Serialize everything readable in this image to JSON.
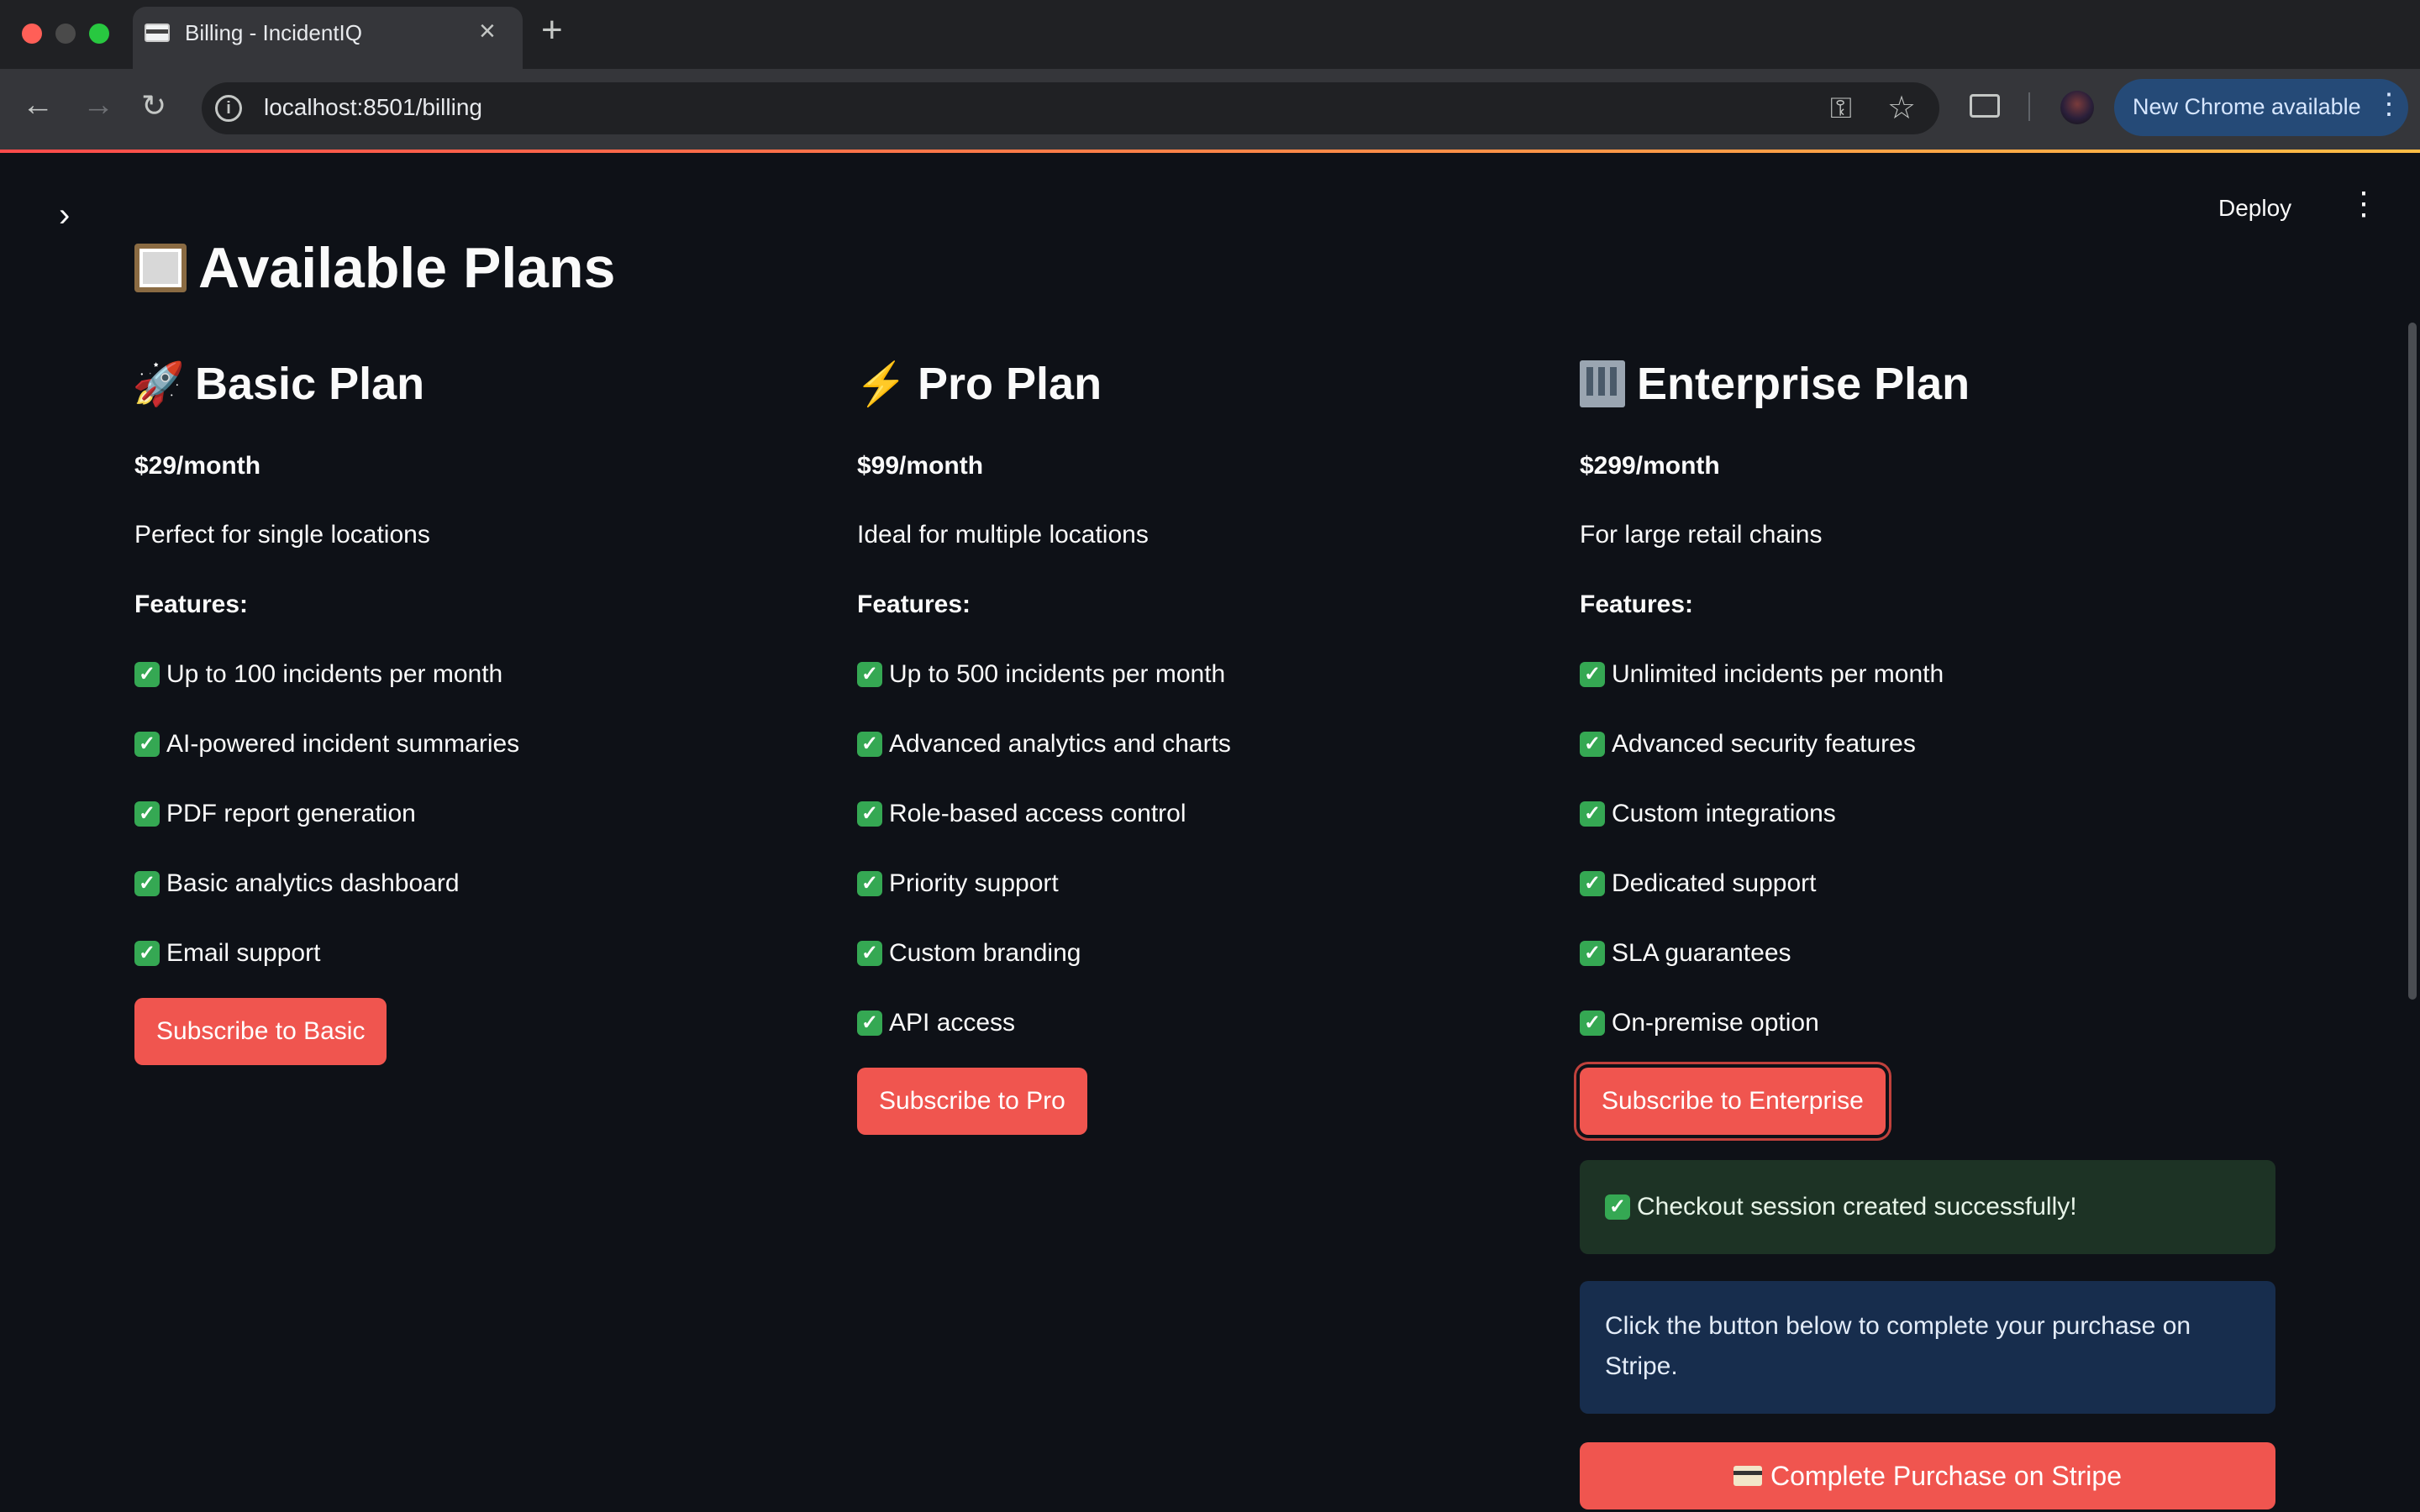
{
  "browser": {
    "tab_title": "Billing - IncidentIQ",
    "url": "localhost:8501/billing",
    "update_button": "New Chrome available"
  },
  "app": {
    "deploy_label": "Deploy",
    "page_title": "Available Plans",
    "plans": [
      {
        "name": "Basic Plan",
        "icon": "rocket-icon",
        "price": "$29/month",
        "description": "Perfect for single locations",
        "features_title": "Features:",
        "features": [
          "Up to 100 incidents per month",
          "AI-powered incident summaries",
          "PDF report generation",
          "Basic analytics dashboard",
          "Email support"
        ],
        "button": "Subscribe to Basic"
      },
      {
        "name": "Pro Plan",
        "icon": "lightning-icon",
        "price": "$99/month",
        "description": "Ideal for multiple locations",
        "features_title": "Features:",
        "features": [
          "Up to 500 incidents per month",
          "Advanced analytics and charts",
          "Role-based access control",
          "Priority support",
          "Custom branding",
          "API access"
        ],
        "button": "Subscribe to Pro"
      },
      {
        "name": "Enterprise Plan",
        "icon": "office-building-icon",
        "price": "$299/month",
        "description": "For large retail chains",
        "features_title": "Features:",
        "features": [
          "Unlimited incidents per month",
          "Advanced security features",
          "Custom integrations",
          "Dedicated support",
          "SLA guarantees",
          "On-premise option"
        ],
        "button": "Subscribe to Enterprise"
      }
    ],
    "success_message": "Checkout session created successfully!",
    "info_message": "Click the button below to complete your purchase on Stripe.",
    "stripe_button": "Complete Purchase on Stripe"
  },
  "colors": {
    "background": "#0e1117",
    "primary_button": "#f0554f",
    "success_bg": "#1d3325",
    "info_bg": "#172d4d"
  }
}
